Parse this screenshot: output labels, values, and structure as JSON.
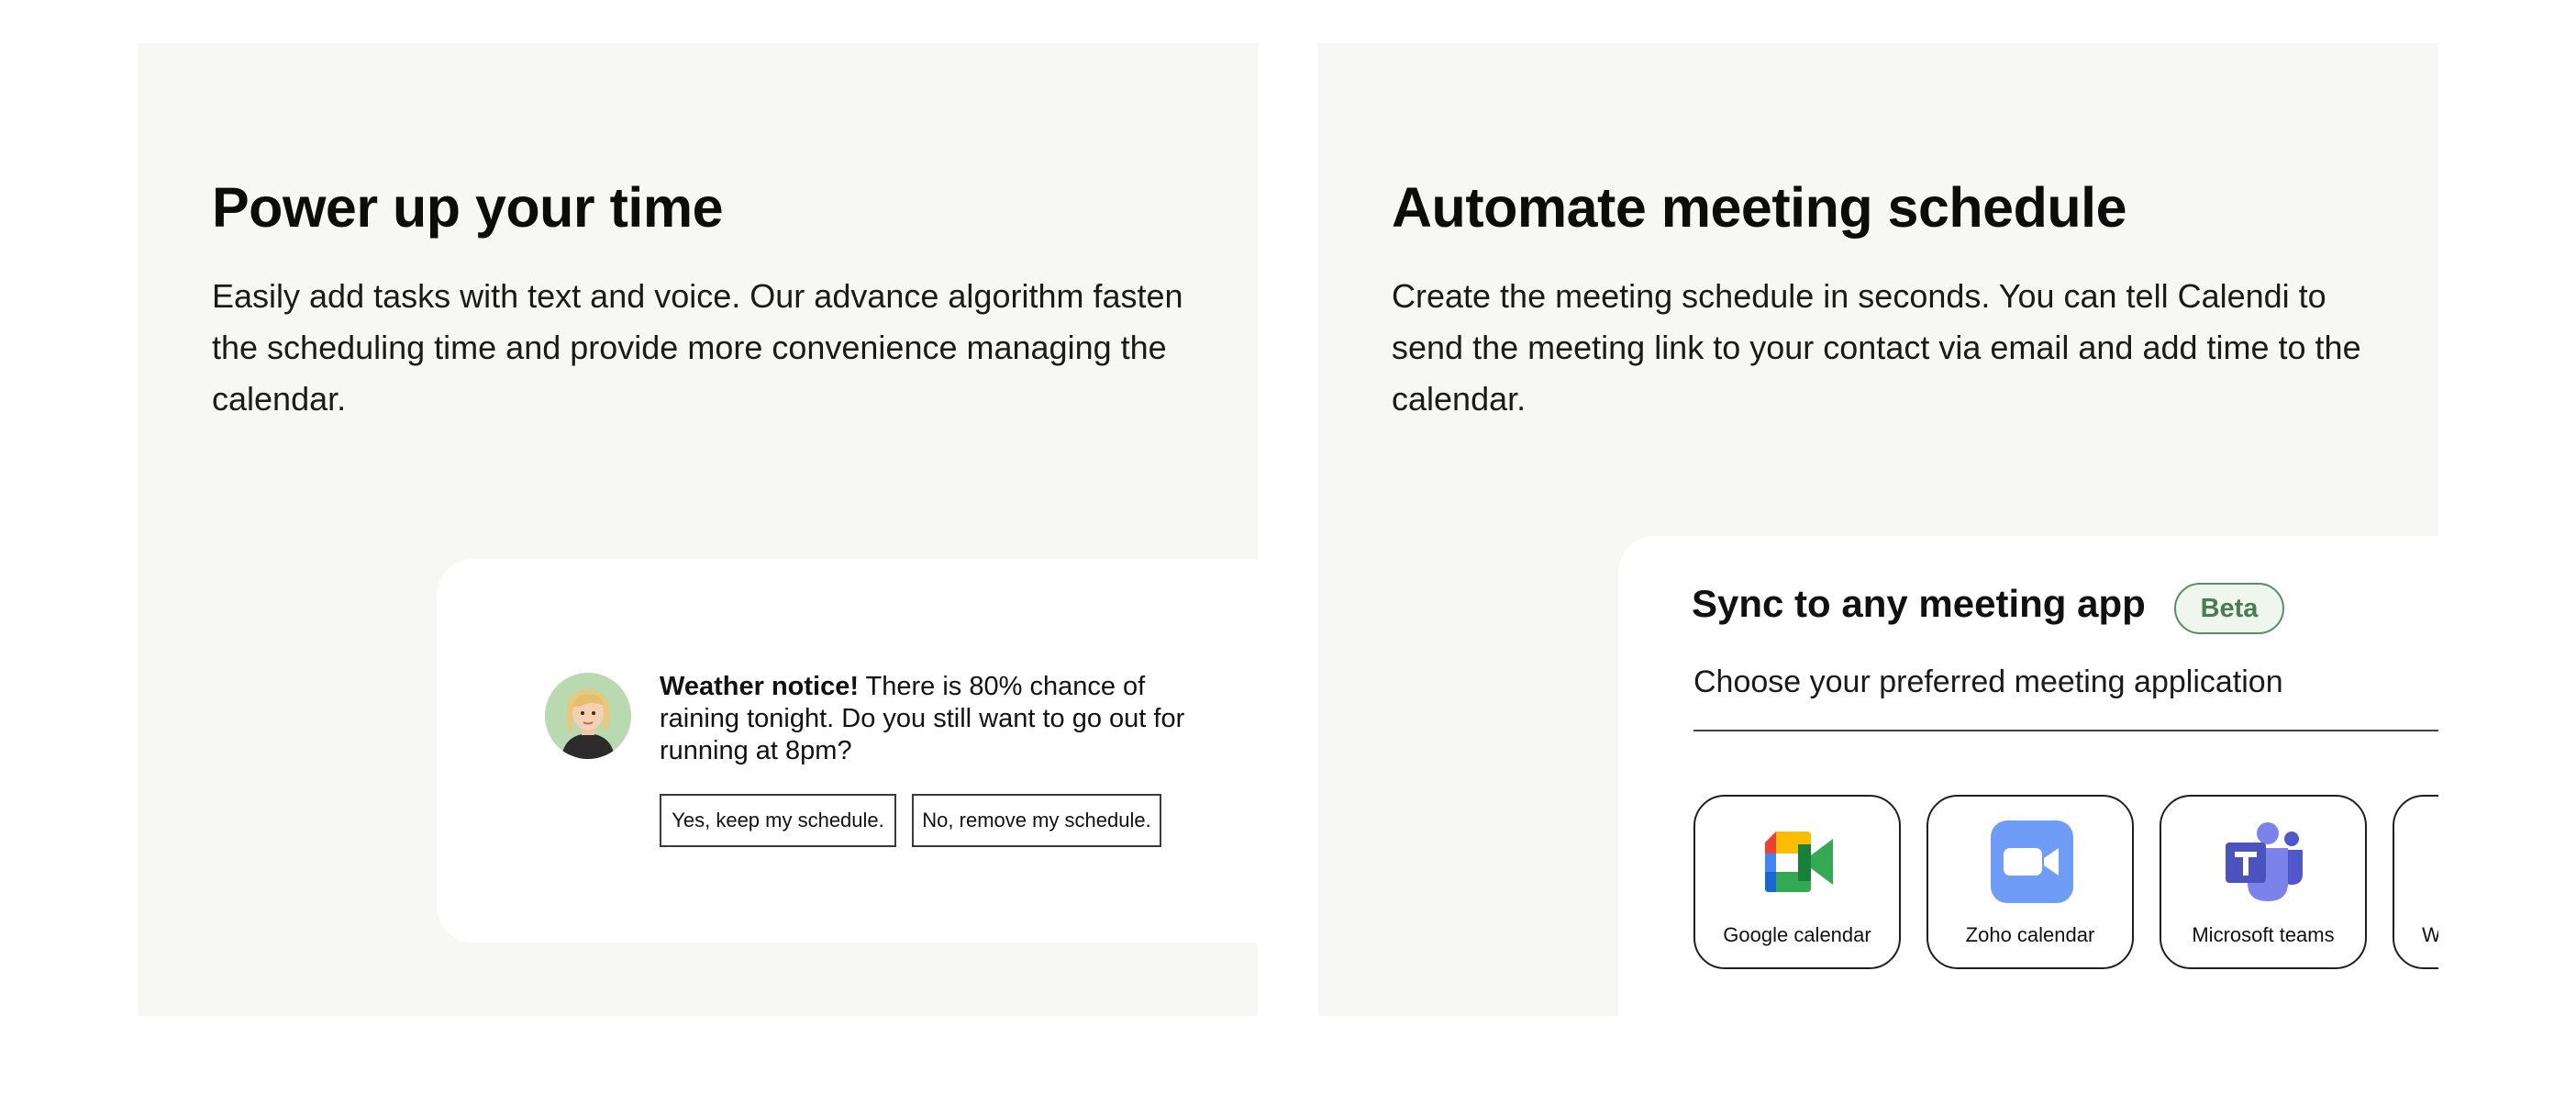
{
  "features": [
    {
      "title": "Power up your time",
      "description": "Easily add tasks with text and voice. Our advance algorithm fasten the scheduling time and provide more convenience managing the calendar.",
      "notice": {
        "heading": "Weather notice!",
        "message": " There is 80% chance of raining tonight. Do you still want to go out for running at 8pm?",
        "yes_label": "Yes, keep my schedule.",
        "no_label": "No, remove my schedule.",
        "avatar_icon": "woman-avatar-icon"
      }
    },
    {
      "title": "Automate meeting schedule",
      "description": "Create the meeting schedule in seconds. You can tell Calendi to send the meeting link to your contact via email and add time to the calendar.",
      "sync": {
        "title": "Sync to any meeting app",
        "badge": "Beta",
        "subtitle": "Choose your preferred meeting application",
        "apps": [
          {
            "label": "Google calendar",
            "icon": "google-meet-icon"
          },
          {
            "label": "Zoho calendar",
            "icon": "zoho-video-icon"
          },
          {
            "label": "Microsoft teams",
            "icon": "microsoft-teams-icon"
          },
          {
            "label": "W",
            "icon": "partial-app-icon"
          }
        ]
      }
    }
  ],
  "colors": {
    "card_bg": "#f7f7f5",
    "beta_accent": "#4c7a55",
    "zoho_blue": "#6e9cf7",
    "teams_purple": "#5059c9"
  }
}
